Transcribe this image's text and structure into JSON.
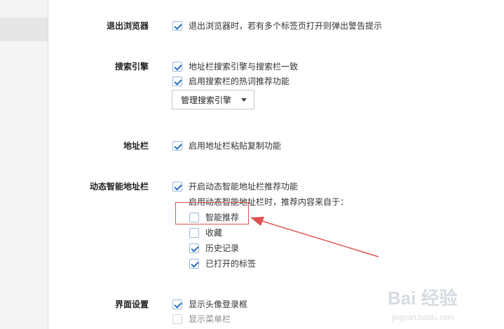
{
  "sections": {
    "exit_browser": {
      "title": "退出浏览器",
      "options": [
        {
          "label": "退出浏览器时，若有多个标签页打开则弹出警告提示",
          "checked": true
        }
      ]
    },
    "search_engine": {
      "title": "搜索引擎",
      "options": [
        {
          "label": "地址栏搜索引擎与搜索栏一致",
          "checked": true
        },
        {
          "label": "启用搜索栏的热词推荐功能",
          "checked": true
        }
      ],
      "dropdown_label": "管理搜索引擎"
    },
    "address_bar": {
      "title": "地址栏",
      "options": [
        {
          "label": "启用地址栏粘贴复制功能",
          "checked": true
        }
      ]
    },
    "smart_address_bar": {
      "title": "动态智能地址栏",
      "options": [
        {
          "label": "开启动态智能地址栏推荐功能",
          "checked": true
        }
      ],
      "source_note": "启用动态智能地址栏时，推荐内容来自于：",
      "sources": [
        {
          "label": "智能推荐",
          "checked": false
        },
        {
          "label": "收藏",
          "checked": false
        },
        {
          "label": "历史记录",
          "checked": true
        },
        {
          "label": "已打开的标签",
          "checked": true
        }
      ]
    },
    "interface": {
      "title": "界面设置",
      "options": [
        {
          "label": "显示头像登录框",
          "checked": true
        },
        {
          "label": "显示菜单栏",
          "checked": false
        }
      ]
    }
  },
  "annotation": {
    "color": "#e05050"
  },
  "watermark": {
    "brand": "Bai 经验",
    "url": "jingyan.baidu.com"
  },
  "colors": {
    "checkbox_border": "#9fb8d6",
    "checkmark": "#2a6fbf",
    "sidebar_bg": "#f4f4f4"
  }
}
